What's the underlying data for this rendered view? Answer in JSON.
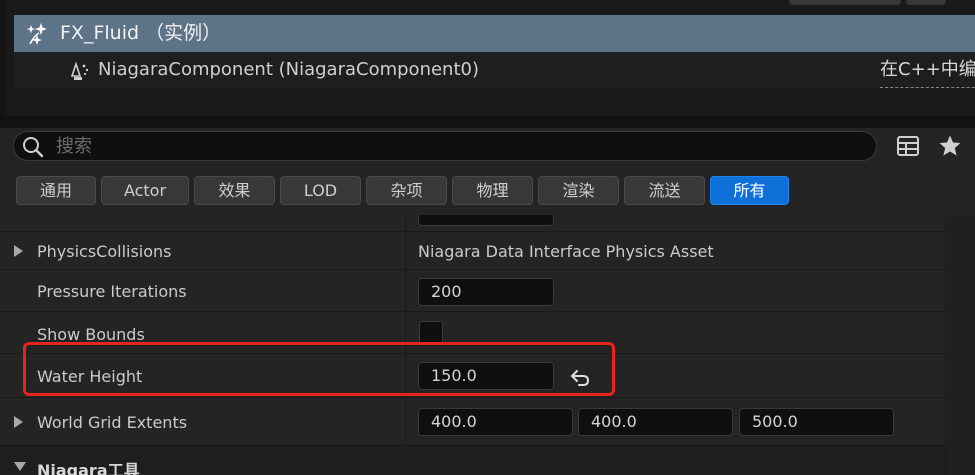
{
  "outliner": {
    "root_item": "FX_Fluid （实例）",
    "child_item": "NiagaraComponent (NiagaraComponent0)",
    "edit_link": "在C++中编辑"
  },
  "search": {
    "placeholder": "搜索",
    "value": ""
  },
  "filter_tabs": [
    {
      "label": "通用",
      "active": false
    },
    {
      "label": "Actor",
      "active": false
    },
    {
      "label": "效果",
      "active": false
    },
    {
      "label": "LOD",
      "active": false
    },
    {
      "label": "杂项",
      "active": false
    },
    {
      "label": "物理",
      "active": false
    },
    {
      "label": "渲染",
      "active": false
    },
    {
      "label": "流送",
      "active": false
    },
    {
      "label": "所有",
      "active": true
    }
  ],
  "properties": {
    "physics_collisions": {
      "name": "PhysicsCollisions",
      "value": "Niagara Data Interface Physics Asset"
    },
    "pressure_iterations": {
      "name": "Pressure Iterations",
      "value": "200"
    },
    "show_bounds": {
      "name": "Show Bounds",
      "checked": false
    },
    "water_height": {
      "name": "Water Height",
      "value": "150.0"
    },
    "world_grid_extents": {
      "name": "World Grid Extents",
      "x": "400.0",
      "y": "400.0",
      "z": "500.0"
    },
    "niagara_tools_category": {
      "name": "Niagara工具"
    }
  },
  "colors": {
    "selected_row": "#5d7388",
    "active_tab": "#0e70d8",
    "highlight_box": "#e8231c"
  }
}
